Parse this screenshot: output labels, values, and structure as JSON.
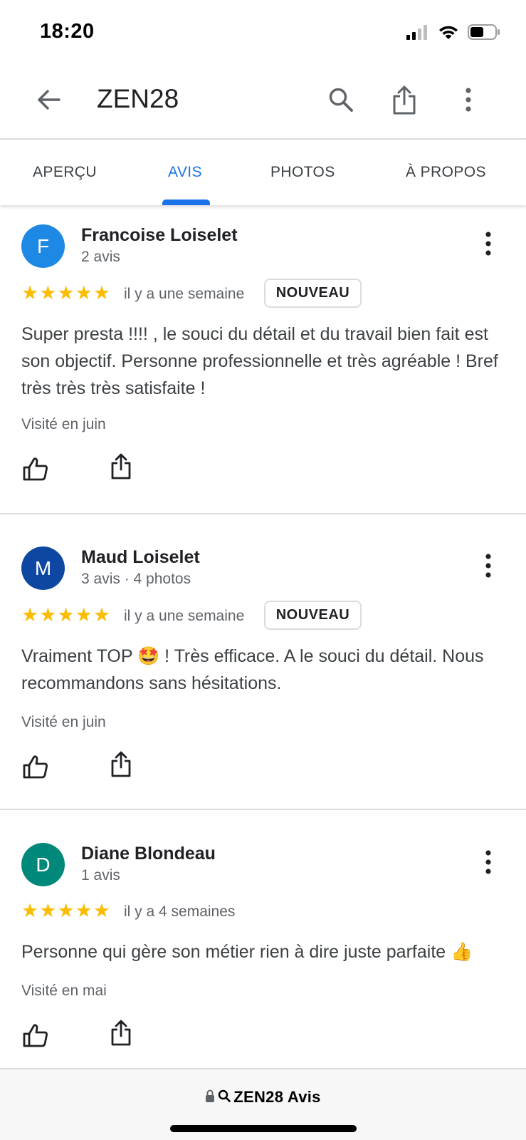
{
  "status_bar": {
    "time": "18:20"
  },
  "header": {
    "title": "ZEN28"
  },
  "tabs": [
    {
      "label": "APERÇU"
    },
    {
      "label": "AVIS"
    },
    {
      "label": "PHOTOS"
    },
    {
      "label": "À PROPOS"
    }
  ],
  "active_tab": "AVIS",
  "colors": {
    "accent": "#1a73e8",
    "star": "#fbbc04",
    "avatar_f": "#1e88e5",
    "avatar_m": "#0d47a1",
    "avatar_d": "#00897b"
  },
  "reviews": [
    {
      "initial": "F",
      "name": "Francoise Loiselet",
      "meta": "2 avis",
      "rating": 5,
      "date": "il y a une semaine",
      "badge": "NOUVEAU",
      "text": "Super presta !!!! , le souci du détail et du travail bien fait est son objectif. Personne professionnelle et très agréable ! Bref très très très satisfaite !",
      "visited": "Visité en juin"
    },
    {
      "initial": "M",
      "name": "Maud Loiselet",
      "meta": "3 avis · 4 photos",
      "rating": 5,
      "date": "il y a une semaine",
      "badge": "NOUVEAU",
      "text_before_emoji": "Vraiment TOP ",
      "emoji": "🤩",
      "text_after_emoji": " ! Très efficace. A le souci du détail. Nous recommandons sans hésitations.",
      "visited": "Visité en juin"
    },
    {
      "initial": "D",
      "name": "Diane Blondeau",
      "meta": "1 avis",
      "rating": 5,
      "date": "il y a 4 semaines",
      "text": "Personne qui gère son métier rien à dire juste parfaite ",
      "emoji": "👍",
      "visited": "Visité en mai"
    }
  ],
  "bottom_bar": {
    "url": "ZEN28 Avis"
  }
}
